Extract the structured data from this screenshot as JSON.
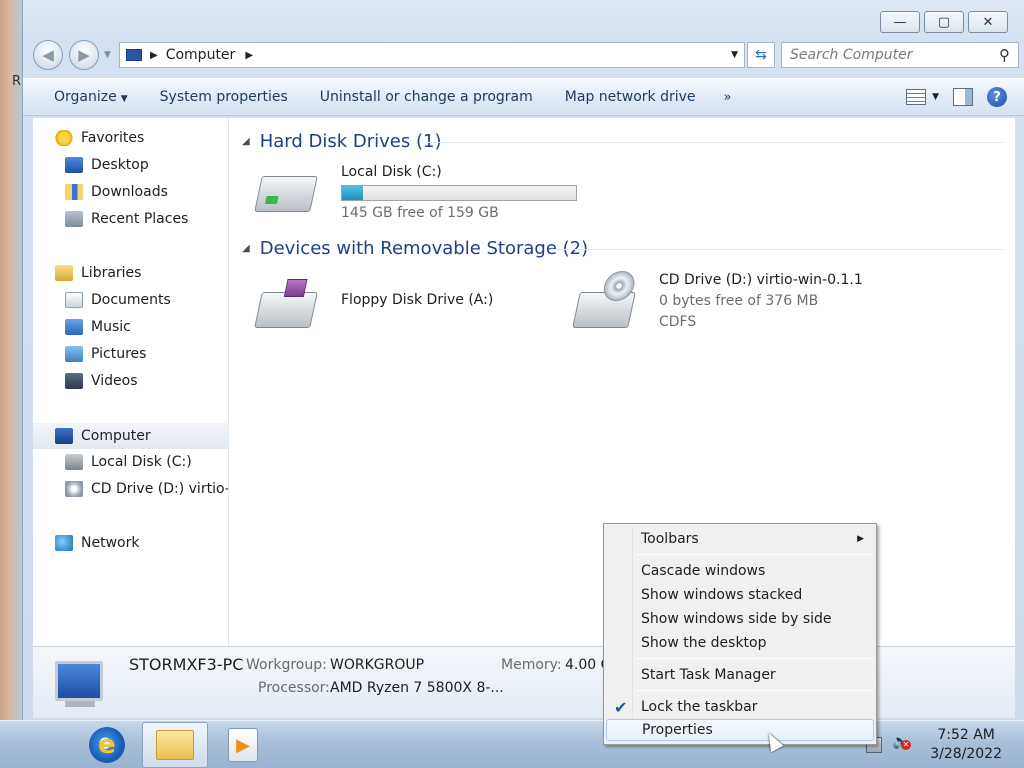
{
  "desktop": {
    "edge_text": "R"
  },
  "window": {
    "caption_buttons": {
      "minimize": "—",
      "maximize": "▢",
      "close": "✕"
    }
  },
  "address_bar": {
    "crumbs": [
      "Computer"
    ],
    "search_placeholder": "Search Computer"
  },
  "toolbar": {
    "organize": "Organize",
    "system_properties": "System properties",
    "uninstall": "Uninstall or change a program",
    "map_drive": "Map network drive",
    "more": "»"
  },
  "nav_pane": {
    "favorites": "Favorites",
    "desktop": "Desktop",
    "downloads": "Downloads",
    "recent": "Recent Places",
    "libraries": "Libraries",
    "documents": "Documents",
    "music": "Music",
    "pictures": "Pictures",
    "videos": "Videos",
    "computer": "Computer",
    "local_disk": "Local Disk (C:)",
    "cd_drive": "CD Drive (D:) virtio-w",
    "network": "Network"
  },
  "main": {
    "hdd_group": "Hard Disk Drives (1)",
    "removable_group": "Devices with Removable Storage (2)",
    "local_disk": {
      "name": "Local Disk (C:)",
      "free": "145 GB free of 159 GB",
      "used_fraction": 0.088
    },
    "floppy": {
      "name": "Floppy Disk Drive (A:)"
    },
    "cd": {
      "name": "CD Drive (D:) virtio-win-0.1.1",
      "free": "0 bytes free of 376 MB",
      "fs": "CDFS"
    }
  },
  "details": {
    "pc_name": "STORMXF3-PC",
    "workgroup_label": "Workgroup:",
    "workgroup": "WORKGROUP",
    "memory_label": "Memory:",
    "memory": "4.00 G",
    "processor_label": "Processor:",
    "processor": "AMD Ryzen 7 5800X 8-..."
  },
  "context_menu": {
    "toolbars": "Toolbars",
    "cascade": "Cascade windows",
    "stacked": "Show windows stacked",
    "side_by_side": "Show windows side by side",
    "show_desktop": "Show the desktop",
    "task_manager": "Start Task Manager",
    "lock_taskbar": "Lock the taskbar",
    "properties": "Properties"
  },
  "taskbar": {
    "time": "7:52 AM",
    "date": "3/28/2022"
  },
  "colors": {
    "group_heading": "#1e3f8a",
    "capacity_fill": "#1f8fb6",
    "accent": "#2b55a6"
  }
}
